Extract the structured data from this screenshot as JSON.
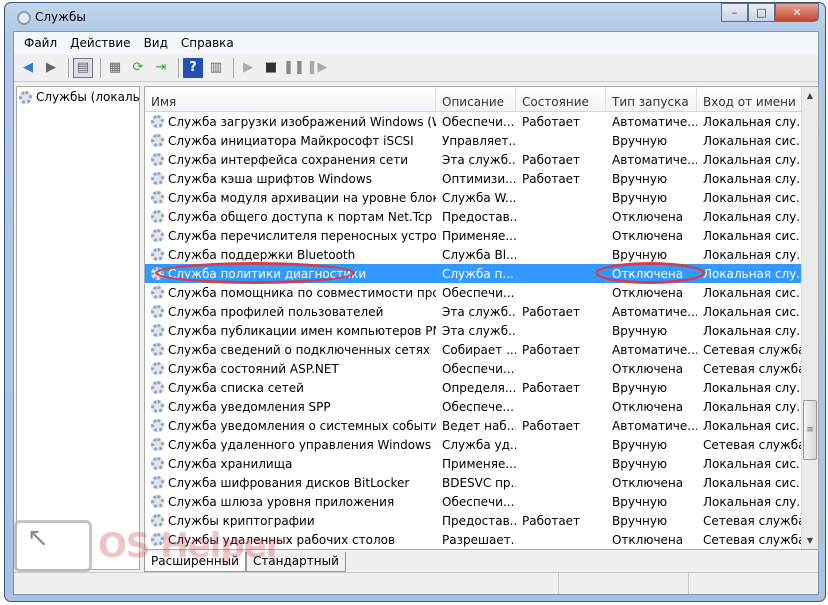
{
  "window": {
    "title": "Службы",
    "minimize": "–",
    "maximize": "□",
    "close": "✕"
  },
  "menu": [
    "Файл",
    "Действие",
    "Вид",
    "Справка"
  ],
  "left_pane": {
    "item": "Службы (локальные)"
  },
  "columns": [
    "Имя",
    "Описание",
    "Состояние",
    "Тип запуска",
    "Вход от имени"
  ],
  "rows": [
    [
      "Служба загрузки изображений Windows (WIA)",
      "Обеспечи...",
      "Работает",
      "Автоматиче...",
      "Локальная слу..."
    ],
    [
      "Служба инициатора Майкрософт iSCSI",
      "Управляет...",
      "",
      "Вручную",
      "Локальная сис..."
    ],
    [
      "Служба интерфейса сохранения сети",
      "Эта служб...",
      "Работает",
      "Автоматиче...",
      "Локальная слу..."
    ],
    [
      "Служба кэша шрифтов Windows",
      "Оптимизи...",
      "Работает",
      "Вручную",
      "Локальная слу..."
    ],
    [
      "Служба модуля архивации на уровне блоков",
      "Служба W...",
      "",
      "Вручную",
      "Локальная сис..."
    ],
    [
      "Служба общего доступа к портам Net.Tcp",
      "Предостав...",
      "",
      "Отключена",
      "Локальная слу..."
    ],
    [
      "Служба перечислителя переносных устройств",
      "Применяе...",
      "",
      "Отключена",
      "Локальная сис..."
    ],
    [
      "Служба поддержки Bluetooth",
      "Служба Bl...",
      "",
      "Вручную",
      "Локальная слу..."
    ],
    [
      "Служба политики диагностики",
      "Служба п...",
      "",
      "Отключена",
      "Локальная слу..."
    ],
    [
      "Служба помощника по совместимости прогр...",
      "Обеспечи...",
      "",
      "Отключена",
      "Локальная сис..."
    ],
    [
      "Служба профилей пользователей",
      "Эта служб...",
      "Работает",
      "Автоматиче...",
      "Локальная сис..."
    ],
    [
      "Служба публикации имен компьютеров PNRP",
      "Эта служб...",
      "",
      "Вручную",
      "Локальная слу..."
    ],
    [
      "Служба сведений о подключенных сетях",
      "Собирает ...",
      "Работает",
      "Автоматиче...",
      "Сетевая служба"
    ],
    [
      "Служба состояний ASP.NET",
      "Обеспечи...",
      "",
      "Отключена",
      "Сетевая служба"
    ],
    [
      "Служба списка сетей",
      "Определя...",
      "Работает",
      "Вручную",
      "Локальная слу..."
    ],
    [
      "Служба уведомления SPP",
      "Обеспече...",
      "",
      "Отключена",
      "Локальная слу..."
    ],
    [
      "Служба уведомления о системных событиях",
      "Ведет наб...",
      "Работает",
      "Автоматиче...",
      "Локальная сис..."
    ],
    [
      "Служба удаленного управления Windows (WS...",
      "Служба уд...",
      "",
      "Вручную",
      "Сетевая служба"
    ],
    [
      "Служба хранилища",
      "Применяе...",
      "",
      "Вручную",
      "Локальная сис..."
    ],
    [
      "Служба шифрования дисков BitLocker",
      "BDESVC пр...",
      "",
      "Отключена",
      "Локальная сис..."
    ],
    [
      "Служба шлюза уровня приложения",
      "Обеспечи...",
      "",
      "Вручную",
      "Локальная слу..."
    ],
    [
      "Службы криптографии",
      "Предостав...",
      "Работает",
      "Вручную",
      "Сетевая служба"
    ],
    [
      "Службы удаленных рабочих столов",
      "Разрешает...",
      "",
      "Отключена",
      "Сетевая служба"
    ]
  ],
  "selected_row": 8,
  "tabs": [
    "Расширенный",
    "Стандартный"
  ],
  "watermark": "OS Helper"
}
